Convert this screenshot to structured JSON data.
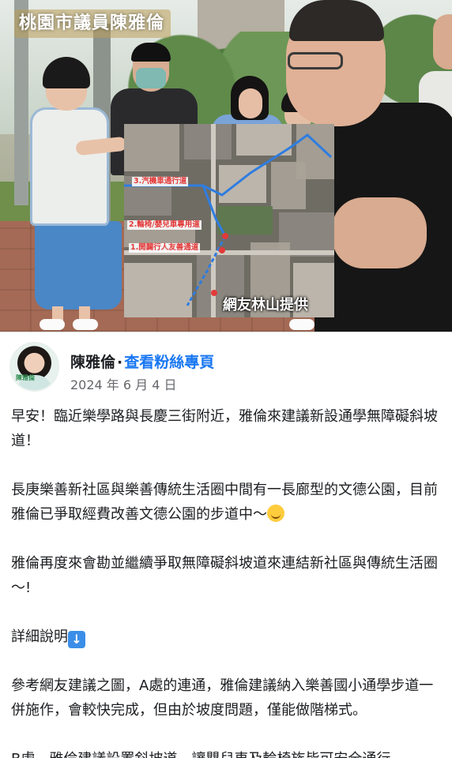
{
  "photo": {
    "title_overlay": "桃園市議員陳雅倫",
    "map_labels": [
      "3.汽機車通行道",
      "2.輪椅/嬰兒車專用道",
      "1.開闢行人友善通道"
    ],
    "map_credit": "網友林山提供",
    "route_color": "#2f7de0",
    "marker_color": "#e23a3a"
  },
  "post_header": {
    "author_name": "陳雅倫",
    "separator": "·",
    "follow_link": "查看粉絲專頁",
    "date": "2024 年 6 月 4 日",
    "avatar_caption": "陳雅倫"
  },
  "post_body": {
    "p1": "早安！臨近樂學路與長慶三街附近，雅倫來建議新設通學無障礙斜坡道！",
    "p2": "長庚樂善新社區與樂善傳統生活圈中間有一長廊型的文德公園，目前雅倫已爭取經費改善文德公園的步道中～",
    "p2_emoji": "smiling-face",
    "p3": "雅倫再度來會勘並繼續爭取無障礙斜坡道來連結新社區與傳統生活圈～!",
    "p4": "詳細說明",
    "p4_emoji": "down-arrow",
    "p5": "參考網友建議之圖，A處的連通，雅倫建議納入樂善國小通學步道一併施作，會較快完成，但由於坡度問題，僅能做階梯式。",
    "p6": "B處，雅倫建議設置斜坡道，讓嬰兒車及輪椅族皆可安全通行。"
  },
  "colors": {
    "link": "#1877f2",
    "text": "#1c1e21",
    "secondary_text": "#65676b"
  }
}
